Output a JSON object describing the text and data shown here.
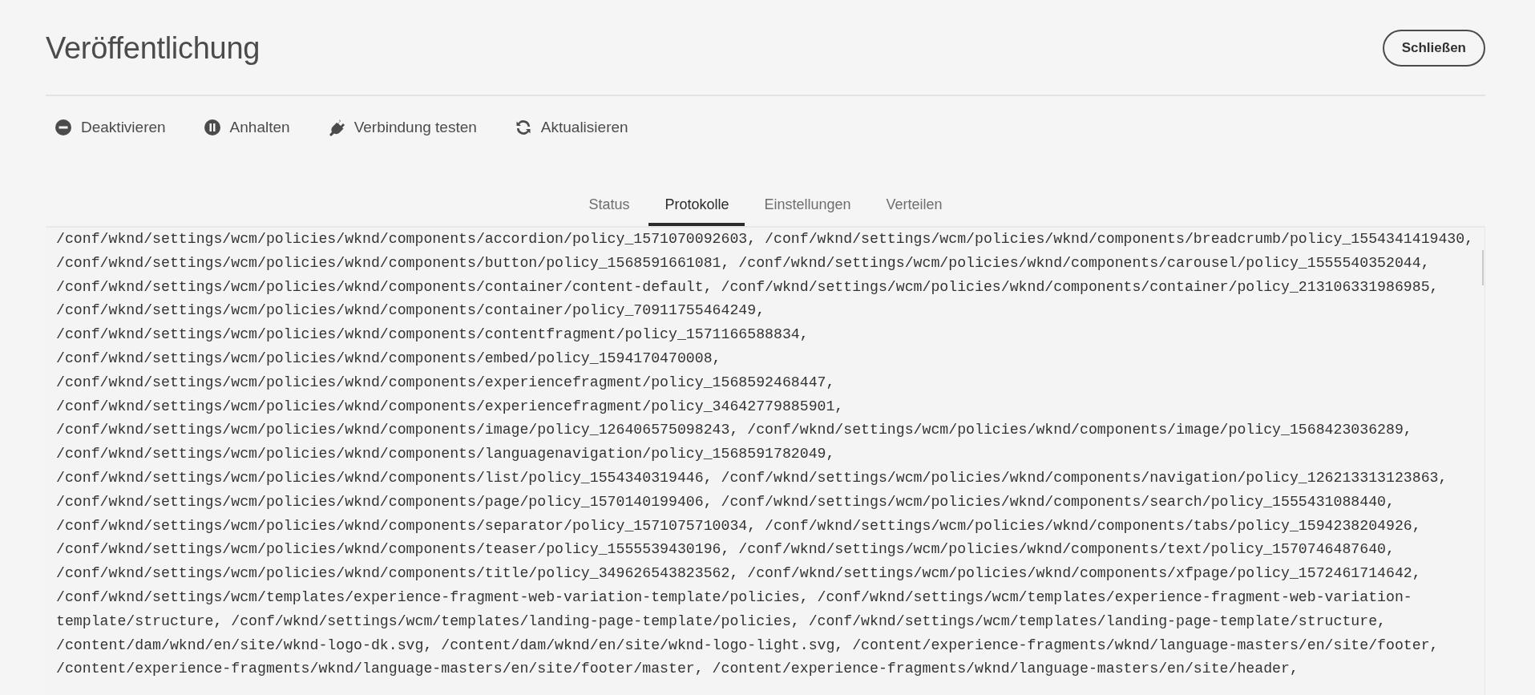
{
  "header": {
    "title": "Veröffentlichung",
    "close_button": "Schließen"
  },
  "toolbar": [
    {
      "kind": "disable",
      "label": "Deaktivieren"
    },
    {
      "kind": "pause",
      "label": "Anhalten"
    },
    {
      "kind": "plug",
      "label": "Verbindung testen"
    },
    {
      "kind": "refresh",
      "label": "Aktualisieren"
    }
  ],
  "tabs": [
    {
      "label": "Status",
      "selected": false
    },
    {
      "label": "Protokolle",
      "selected": true
    },
    {
      "label": "Einstellungen",
      "selected": false
    },
    {
      "label": "Verteilen",
      "selected": false
    }
  ],
  "log_lines": [
    "/conf/wknd/settings/wcm/policies/wknd/components/accordion/policy_1571070092603, /conf/wknd/settings/wcm/policies/wknd/components/breadcrumb/policy_1554341419430,",
    "/conf/wknd/settings/wcm/policies/wknd/components/button/policy_1568591661081, /conf/wknd/settings/wcm/policies/wknd/components/carousel/policy_1555540352044,",
    "/conf/wknd/settings/wcm/policies/wknd/components/container/content-default, /conf/wknd/settings/wcm/policies/wknd/components/container/policy_213106331986985,",
    "/conf/wknd/settings/wcm/policies/wknd/components/container/policy_70911755464249,",
    "/conf/wknd/settings/wcm/policies/wknd/components/contentfragment/policy_1571166588834,",
    "/conf/wknd/settings/wcm/policies/wknd/components/embed/policy_1594170470008,",
    "/conf/wknd/settings/wcm/policies/wknd/components/experiencefragment/policy_1568592468447,",
    "/conf/wknd/settings/wcm/policies/wknd/components/experiencefragment/policy_34642779885901,",
    "/conf/wknd/settings/wcm/policies/wknd/components/image/policy_126406575098243, /conf/wknd/settings/wcm/policies/wknd/components/image/policy_1568423036289,",
    "/conf/wknd/settings/wcm/policies/wknd/components/languagenavigation/policy_1568591782049,",
    "/conf/wknd/settings/wcm/policies/wknd/components/list/policy_1554340319446, /conf/wknd/settings/wcm/policies/wknd/components/navigation/policy_126213313123863,",
    "/conf/wknd/settings/wcm/policies/wknd/components/page/policy_1570140199406, /conf/wknd/settings/wcm/policies/wknd/components/search/policy_1555431088440,",
    "/conf/wknd/settings/wcm/policies/wknd/components/separator/policy_1571075710034, /conf/wknd/settings/wcm/policies/wknd/components/tabs/policy_1594238204926,",
    "/conf/wknd/settings/wcm/policies/wknd/components/teaser/policy_1555539430196, /conf/wknd/settings/wcm/policies/wknd/components/text/policy_1570746487640,",
    "/conf/wknd/settings/wcm/policies/wknd/components/title/policy_349626543823562, /conf/wknd/settings/wcm/policies/wknd/components/xfpage/policy_1572461714642,",
    "/conf/wknd/settings/wcm/templates/experience-fragment-web-variation-template/policies, /conf/wknd/settings/wcm/templates/experience-fragment-web-variation-",
    "template/structure, /conf/wknd/settings/wcm/templates/landing-page-template/policies, /conf/wknd/settings/wcm/templates/landing-page-template/structure,",
    "/content/dam/wknd/en/site/wknd-logo-dk.svg, /content/dam/wknd/en/site/wknd-logo-light.svg, /content/experience-fragments/wknd/language-masters/en/site/footer,",
    "/content/experience-fragments/wknd/language-masters/en/site/footer/master, /content/experience-fragments/wknd/language-masters/en/site/header,"
  ]
}
